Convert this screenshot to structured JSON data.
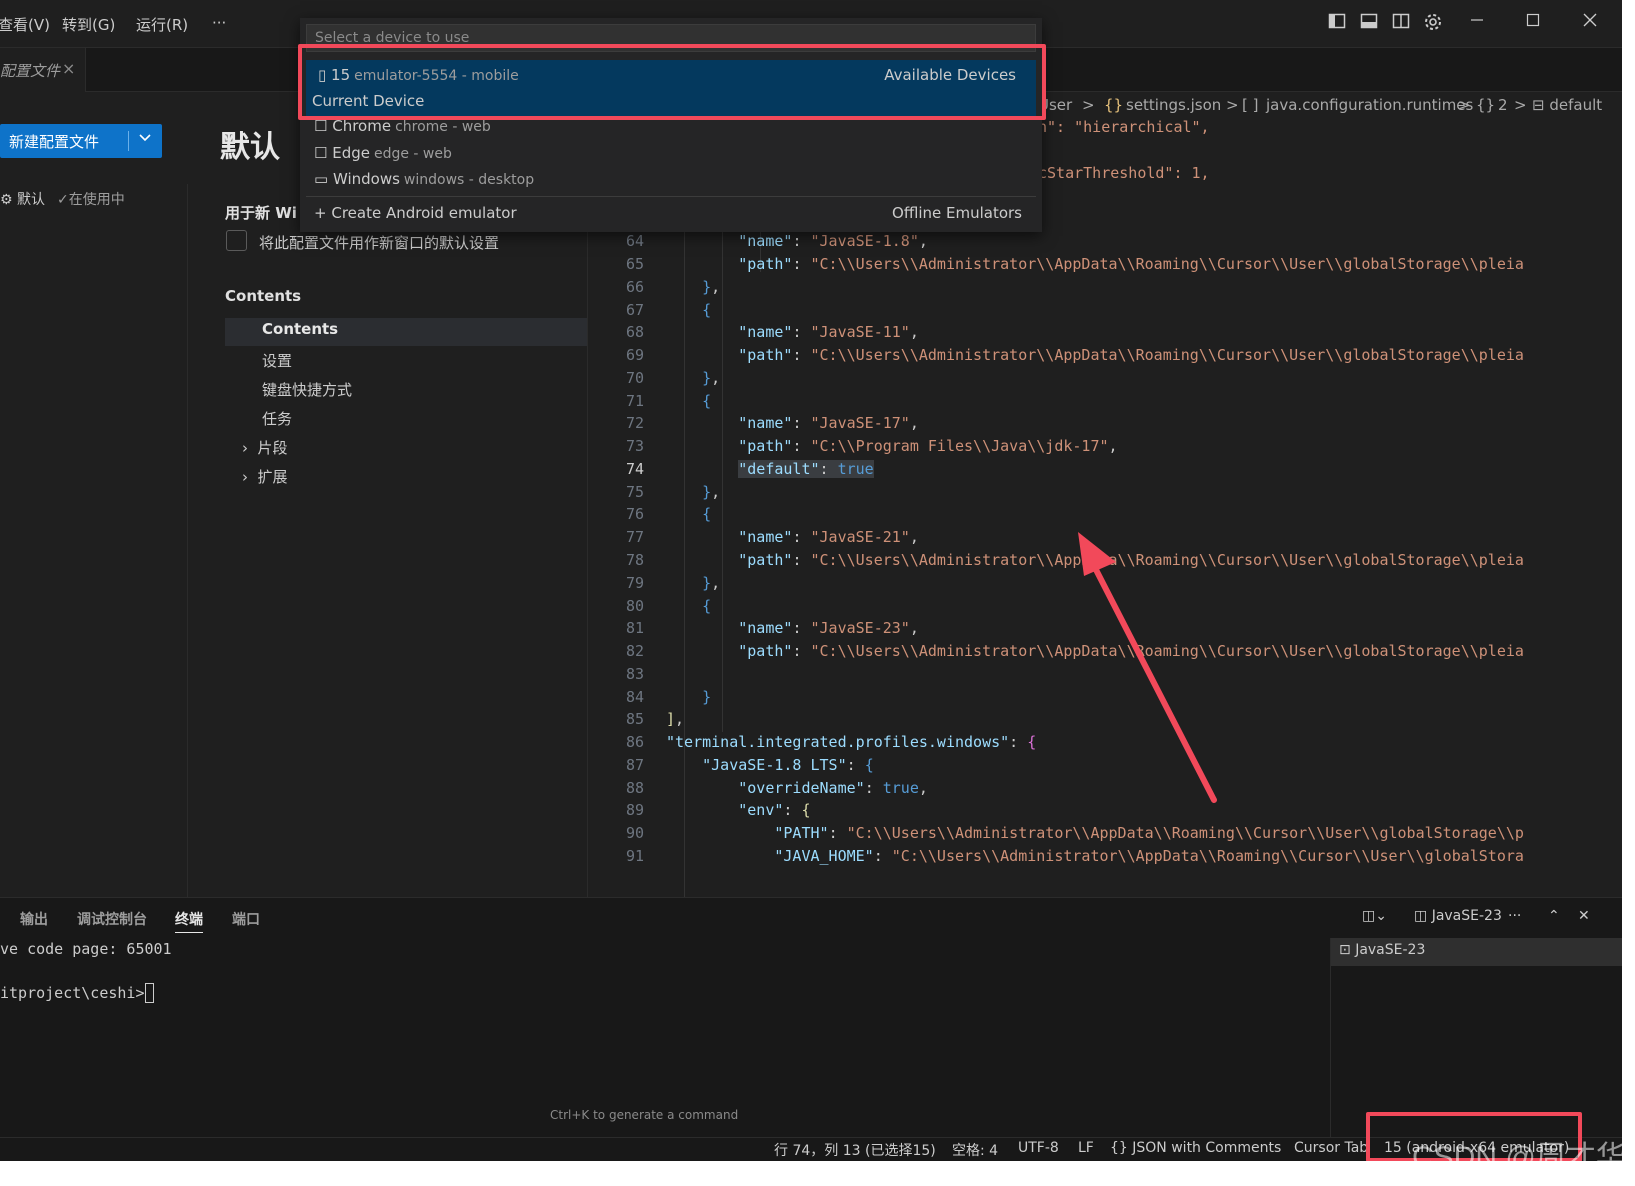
{
  "menu": {
    "view": "查看(V)",
    "goto": "转到(G)",
    "run": "运行(R)",
    "more": "···"
  },
  "tab": {
    "label": "配置文件",
    "close": "×"
  },
  "settings": {
    "new_profile": "新建配置文件",
    "side_profile": "默认",
    "side_in_use": "✓在使用中",
    "title": "默认",
    "use_for_new": "用于新 Wi",
    "checkbox_label": "将此配置文件用作新窗口的默认设置",
    "contents_heading": "Contents",
    "tree": [
      "Contents",
      "设置",
      "键盘快捷方式",
      "任务",
      "片段",
      "扩展"
    ]
  },
  "breadcrumb": [
    "User",
    ">",
    "{}",
    "settings.json",
    ">",
    "[ ]",
    "java.configuration.runtimes",
    ">",
    "{}",
    "2",
    ">",
    "default"
  ],
  "code_top": [
    {
      "text": "n\": \"hierarchical\","
    },
    {
      "text": "cStarThreshold\": 1,"
    }
  ],
  "code": [
    {
      "ln": "64",
      "name_key": "\"name\"",
      "name_val": "\"JavaSE-1.8\""
    },
    {
      "ln": "65",
      "path_val": "\"C:\\\\Users\\\\Administrator\\\\AppData\\\\Roaming\\\\Cursor\\\\User\\\\globalStorage\\\\pleia"
    }
  ],
  "lines": {
    "l64": "64",
    "l65": "65",
    "l66": "66",
    "l67": "67",
    "l68": "68",
    "l69": "69",
    "l70": "70",
    "l71": "71",
    "l72": "72",
    "l73": "73",
    "l74": "74",
    "l75": "75",
    "l76": "76",
    "l77": "77",
    "l78": "78",
    "l79": "79",
    "l80": "80",
    "l81": "81",
    "l82": "82",
    "l83": "83",
    "l84": "84",
    "l85": "85",
    "l86": "86",
    "l87": "87",
    "l88": "88",
    "l89": "89",
    "l90": "90",
    "l91": "91"
  },
  "strings": {
    "name_key": "\"name\"",
    "path_key": "\"path\"",
    "v18": "\"JavaSE-1.8\"",
    "v11": "\"JavaSE-11\"",
    "v17": "\"JavaSE-17\"",
    "v21": "\"JavaSE-21\"",
    "v23": "\"JavaSE-23\"",
    "path_long": "\"C:\\\\Users\\\\Administrator\\\\AppData\\\\Roaming\\\\Cursor\\\\User\\\\globalStorage\\\\pleia",
    "path_jdk17": "\"C:\\\\Program Files\\\\Java\\\\jdk-17\"",
    "default_key": "\"default\"",
    "default_val": "true",
    "profiles_key": "\"terminal.integrated.profiles.windows\"",
    "lts_key": "\"JavaSE-1.8 LTS\"",
    "override_key": "\"overrideName\"",
    "override_val": "true",
    "env_key": "\"env\"",
    "path_upper_key": "\"PATH\"",
    "path_upper_val": "\"C:\\\\Users\\\\Administrator\\\\AppData\\\\Roaming\\\\Cursor\\\\User\\\\globalStorage\\\\p",
    "javahome_key": "\"JAVA_HOME\"",
    "javahome_val": "\"C:\\\\Users\\\\Administrator\\\\AppData\\\\Roaming\\\\Cursor\\\\User\\\\globalStora"
  },
  "picker": {
    "placeholder": "Select a device to use",
    "selected": {
      "name": "15",
      "detail": "emulator-5554 - mobile",
      "right": "Available Devices",
      "sub": "Current Device"
    },
    "items": [
      {
        "name": "Chrome",
        "detail": "chrome - web"
      },
      {
        "name": "Edge",
        "detail": "edge - web"
      },
      {
        "name": "Windows",
        "detail": "windows - desktop"
      }
    ],
    "create": "Create Android emulator",
    "create_right": "Offline Emulators"
  },
  "panel": {
    "tabs": [
      "输出",
      "调试控制台",
      "终端",
      "端口"
    ],
    "term_line1": "ve code page: 65001",
    "term_line2": "itproject\\ceshi>",
    "terminal_name": "JavaSE-23",
    "terminal_list_item": "JavaSE-23",
    "hint": "Ctrl+K to generate a command"
  },
  "status": {
    "position": "行 74，列 13 (已选择15)",
    "spaces": "空格: 4",
    "encoding": "UTF-8",
    "eol": "LF",
    "language": "JSON with Comments",
    "cursor_tab": "Cursor Tab",
    "device": "15 (android-x64 emulator)"
  },
  "watermark": "CSDN @周才华",
  "colors": {
    "accent": "#0e73c9",
    "highlight": "#f2495a",
    "selection": "#04395e"
  },
  "icons": [
    "layout-sidebar-icon",
    "layout-panel-icon",
    "layout-split-icon",
    "gear-icon",
    "minimize-icon",
    "maximize-icon",
    "close-icon"
  ]
}
